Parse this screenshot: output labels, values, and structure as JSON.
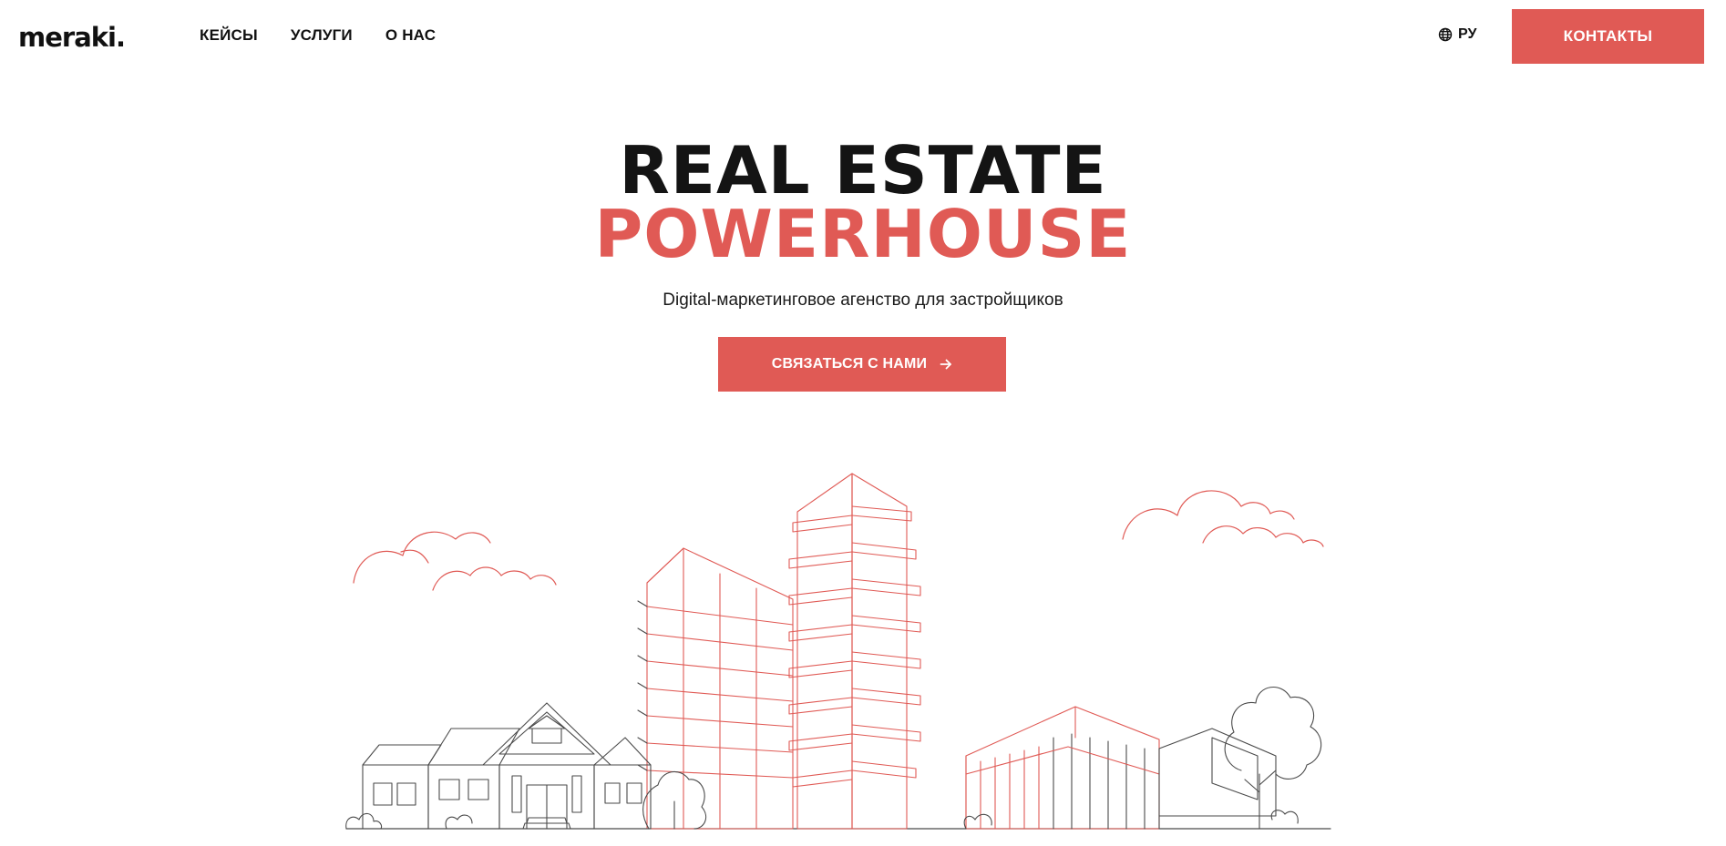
{
  "brand": {
    "logo_text": "meraki."
  },
  "nav": {
    "items": [
      {
        "label": "КЕЙСЫ"
      },
      {
        "label": "УСЛУГИ"
      },
      {
        "label": "О НАС"
      }
    ]
  },
  "header": {
    "language": "РУ",
    "language_icon": "globe-icon",
    "contacts_label": "КОНТАКТЫ"
  },
  "hero": {
    "title_line1": "REAL ESTATE",
    "title_line2": "POWERHOUSE",
    "subtitle": "Digital-маркетинговое агенство для застройщиков",
    "cta_label": "СВЯЗАТЬСЯ С НАМИ",
    "cta_icon": "arrow-right-icon"
  },
  "colors": {
    "accent": "#e05a55",
    "text": "#141414",
    "line_dark": "#4a4a4a",
    "line_accent": "#e05a55",
    "background": "#ffffff"
  }
}
